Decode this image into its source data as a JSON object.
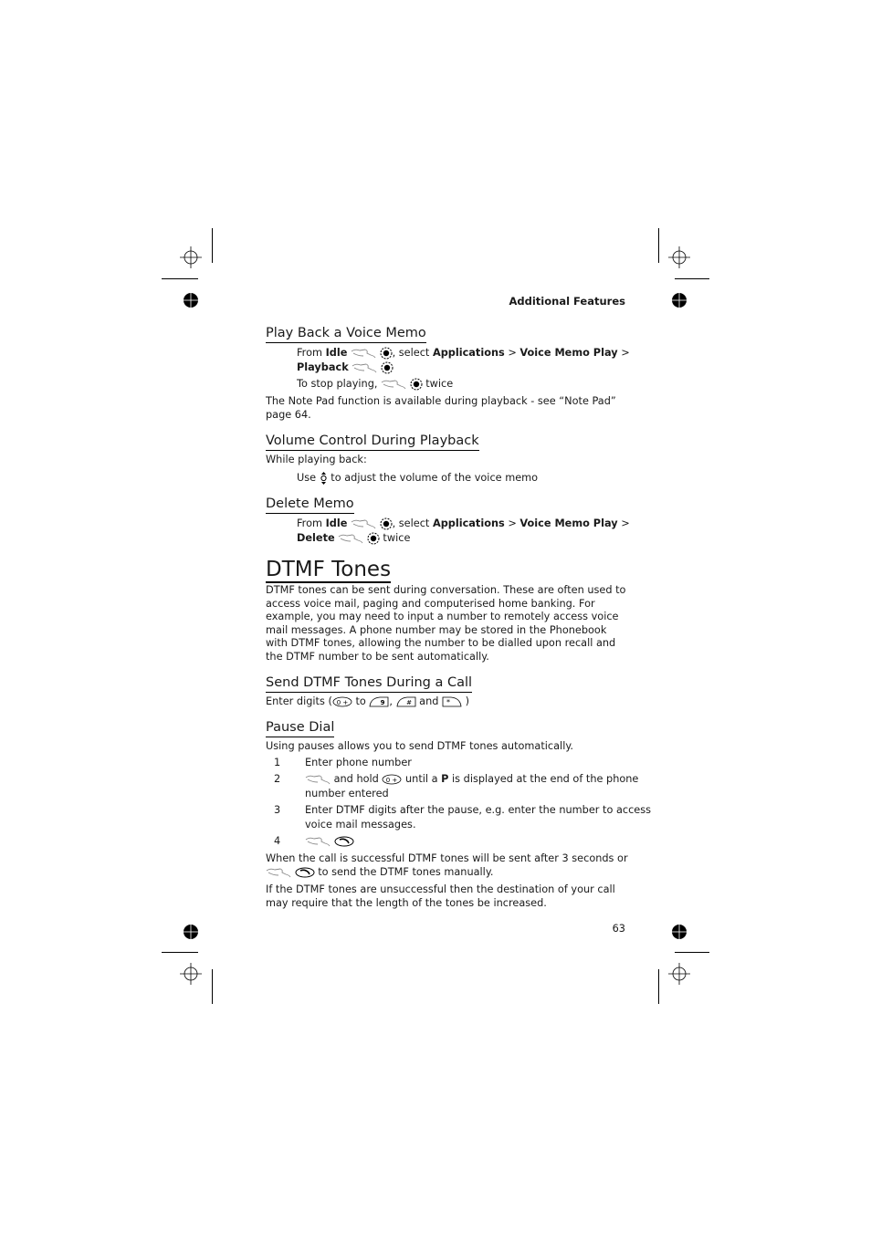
{
  "running_head": "Additional Features",
  "page_number": "63",
  "sections": {
    "playback": {
      "heading": "Play Back a Voice Memo",
      "line1": {
        "from": "From",
        "idle": "Idle",
        "select": ", select",
        "applications": "Applications",
        "sep1": ">",
        "voice_memo_play": "Voice Memo Play",
        "sep2": ">"
      },
      "line2": {
        "playback": "Playback"
      },
      "line3": {
        "text": "To stop playing,",
        "twice": "twice"
      },
      "note": "The Note Pad function is available during playback - see “Note Pad” page 64."
    },
    "volume": {
      "heading": "Volume Control During Playback",
      "intro": "While playing back:",
      "use": "Use",
      "use_rest": "to adjust the volume of the voice memo"
    },
    "delete": {
      "heading": "Delete Memo",
      "line1": {
        "from": "From",
        "idle": "Idle",
        "select": ", select",
        "applications": "Applications",
        "sep1": ">",
        "voice_memo_play": "Voice Memo Play",
        "sep2": ">"
      },
      "line2": {
        "delete": "Delete",
        "twice": "twice"
      }
    },
    "dtmf": {
      "heading": "DTMF Tones",
      "body": "DTMF tones can be sent during conversation. These are often used to access voice mail, paging and computerised home banking. For example, you may need to input a number to remotely access voice mail messages. A phone number may be stored in the Phonebook with DTMF tones, allowing the number to be dialled upon recall and the DTMF number to be sent automatically."
    },
    "send": {
      "heading": "Send DTMF Tones During a Call",
      "enter": "Enter digits (",
      "to": "to",
      "comma": ",",
      "and": "and",
      "close": ")",
      "keys": {
        "zero": "0 +",
        "nine": "9",
        "hash": "#",
        "star": "*"
      }
    },
    "pause": {
      "heading": "Pause Dial",
      "intro": "Using pauses allows you to send DTMF tones automatically.",
      "steps": [
        {
          "n": "1",
          "text": "Enter phone number"
        },
        {
          "n": "2",
          "a": "and hold",
          "b": "until a",
          "p": "P",
          "c": "is displayed at the end of the phone",
          "d": "number entered"
        },
        {
          "n": "3",
          "text": "Enter DTMF digits after the pause, e.g. enter the number to access",
          "text2": "voice mail messages."
        },
        {
          "n": "4"
        }
      ],
      "success_1": "When the call is successful DTMF tones will be sent after 3 seconds or",
      "success_2": "to send the DTMF tones manually.",
      "fail": "If the DTMF tones are unsuccessful then the destination of your call may require that the length of the tones be increased."
    }
  },
  "icons": {
    "hand": "hand-press-icon",
    "nav": "nav-select-icon",
    "volume": "up-down-icon",
    "call": "call-key-icon",
    "key0": "zero-key-icon",
    "key9": "nine-key-icon",
    "keyhash": "hash-key-icon",
    "keystar": "star-key-icon"
  }
}
